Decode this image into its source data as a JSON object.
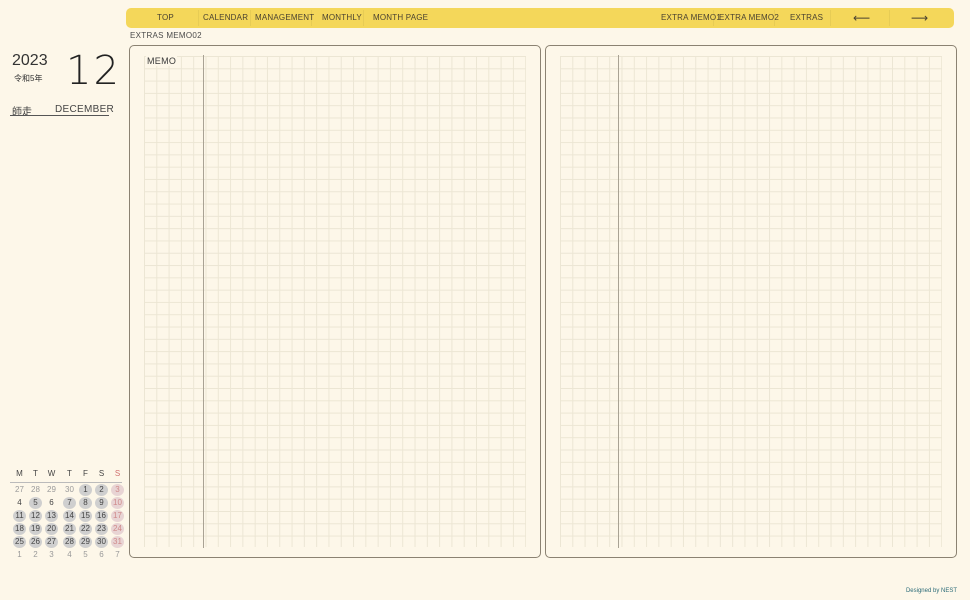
{
  "nav": {
    "items": [
      "TOP",
      "CALENDAR",
      "MANAGEMENT",
      "MONTHLY",
      "MONTH PAGE"
    ],
    "right_items": [
      "EXTRA MEMO1",
      "EXTRA MEMO2",
      "EXTRAS"
    ],
    "prev": "⟵",
    "next": "⟶"
  },
  "page_label": "EXTRAS MEMO02",
  "date": {
    "year": "2023",
    "era": "令和5年",
    "month_number": "12",
    "month_jp": "師走",
    "month_en": "DECEMBER"
  },
  "mini_calendar": {
    "weekdays": [
      "M",
      "T",
      "W",
      "T",
      "F",
      "S",
      "S"
    ],
    "weeks": [
      [
        "27",
        "28",
        "29",
        "30",
        "1",
        "2",
        "3"
      ],
      [
        "4",
        "5",
        "6",
        "7",
        "8",
        "9",
        "10"
      ],
      [
        "11",
        "12",
        "13",
        "14",
        "15",
        "16",
        "17"
      ],
      [
        "18",
        "19",
        "20",
        "21",
        "22",
        "23",
        "24"
      ],
      [
        "25",
        "26",
        "27",
        "28",
        "29",
        "30",
        "31"
      ],
      [
        "1",
        "2",
        "3",
        "4",
        "5",
        "6",
        "7"
      ]
    ]
  },
  "memo": {
    "label": "MEMO"
  },
  "credit": "Designed by NEST",
  "colors": {
    "nav": "#f4d75a",
    "background": "#fdf7e9",
    "panel_border": "#8b8272"
  }
}
